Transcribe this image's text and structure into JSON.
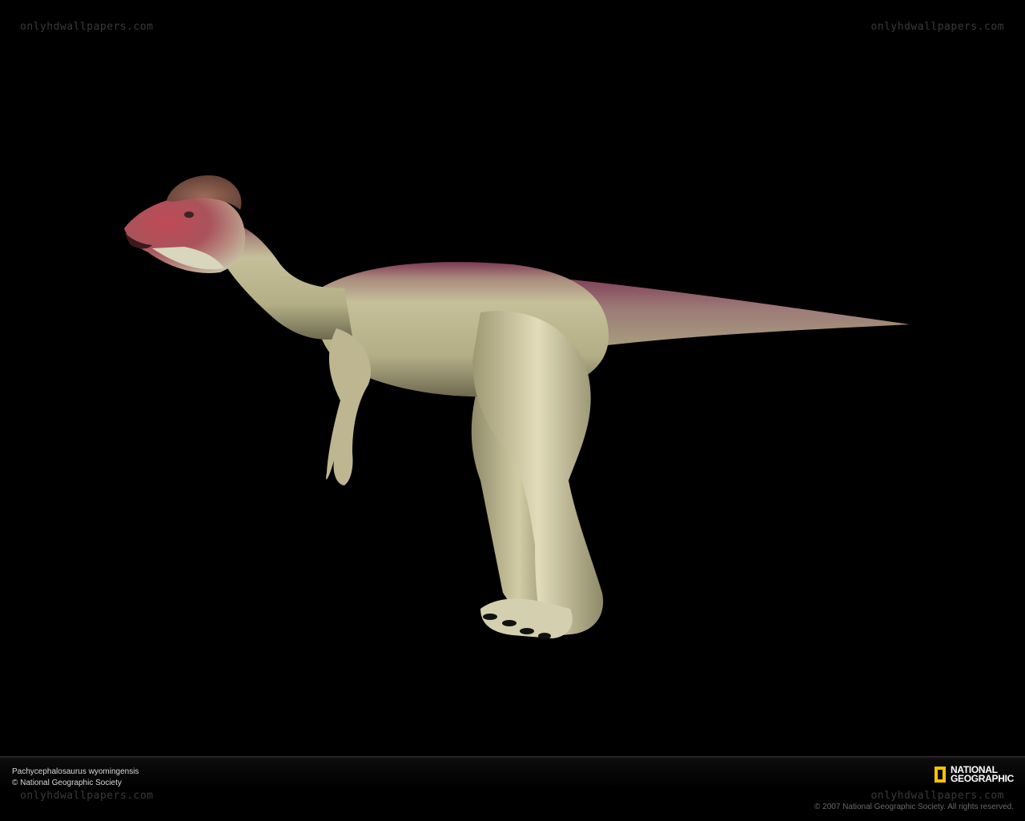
{
  "watermark": {
    "site": "onlyhdwallpapers.com"
  },
  "caption": {
    "title": "Pachycephalosaurus wyomingensis",
    "credit": "© National Geographic Society"
  },
  "brand": {
    "logo_line1": "NATIONAL",
    "logo_line2": "GEOGRAPHIC",
    "logo_color": "#f6c300"
  },
  "copyright": "© 2007 National Geographic Society. All rights reserved.",
  "colors": {
    "background": "#000000",
    "body": "#c9c39a",
    "dorsal_stripe": "#8a3d55",
    "face_red": "#b8333f"
  }
}
